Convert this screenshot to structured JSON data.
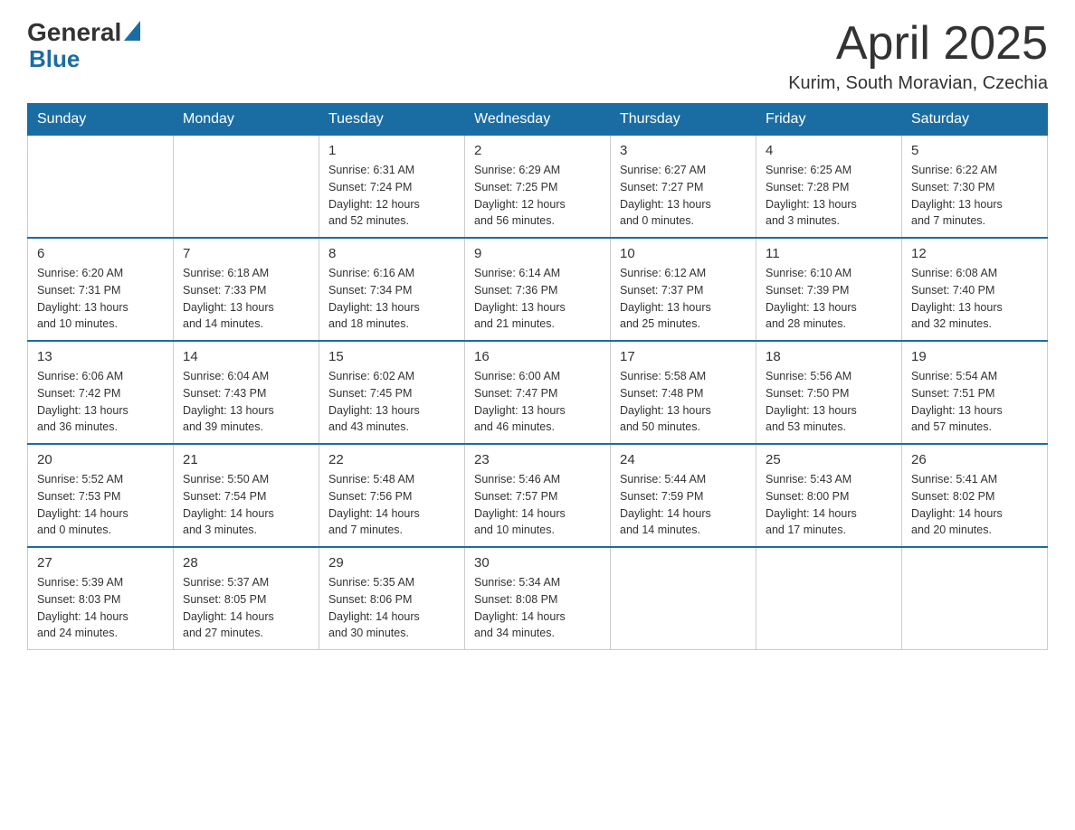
{
  "logo": {
    "text_general": "General",
    "text_blue": "Blue"
  },
  "header": {
    "title": "April 2025",
    "subtitle": "Kurim, South Moravian, Czechia"
  },
  "weekdays": [
    "Sunday",
    "Monday",
    "Tuesday",
    "Wednesday",
    "Thursday",
    "Friday",
    "Saturday"
  ],
  "weeks": [
    [
      {
        "day": "",
        "info": ""
      },
      {
        "day": "",
        "info": ""
      },
      {
        "day": "1",
        "info": "Sunrise: 6:31 AM\nSunset: 7:24 PM\nDaylight: 12 hours\nand 52 minutes."
      },
      {
        "day": "2",
        "info": "Sunrise: 6:29 AM\nSunset: 7:25 PM\nDaylight: 12 hours\nand 56 minutes."
      },
      {
        "day": "3",
        "info": "Sunrise: 6:27 AM\nSunset: 7:27 PM\nDaylight: 13 hours\nand 0 minutes."
      },
      {
        "day": "4",
        "info": "Sunrise: 6:25 AM\nSunset: 7:28 PM\nDaylight: 13 hours\nand 3 minutes."
      },
      {
        "day": "5",
        "info": "Sunrise: 6:22 AM\nSunset: 7:30 PM\nDaylight: 13 hours\nand 7 minutes."
      }
    ],
    [
      {
        "day": "6",
        "info": "Sunrise: 6:20 AM\nSunset: 7:31 PM\nDaylight: 13 hours\nand 10 minutes."
      },
      {
        "day": "7",
        "info": "Sunrise: 6:18 AM\nSunset: 7:33 PM\nDaylight: 13 hours\nand 14 minutes."
      },
      {
        "day": "8",
        "info": "Sunrise: 6:16 AM\nSunset: 7:34 PM\nDaylight: 13 hours\nand 18 minutes."
      },
      {
        "day": "9",
        "info": "Sunrise: 6:14 AM\nSunset: 7:36 PM\nDaylight: 13 hours\nand 21 minutes."
      },
      {
        "day": "10",
        "info": "Sunrise: 6:12 AM\nSunset: 7:37 PM\nDaylight: 13 hours\nand 25 minutes."
      },
      {
        "day": "11",
        "info": "Sunrise: 6:10 AM\nSunset: 7:39 PM\nDaylight: 13 hours\nand 28 minutes."
      },
      {
        "day": "12",
        "info": "Sunrise: 6:08 AM\nSunset: 7:40 PM\nDaylight: 13 hours\nand 32 minutes."
      }
    ],
    [
      {
        "day": "13",
        "info": "Sunrise: 6:06 AM\nSunset: 7:42 PM\nDaylight: 13 hours\nand 36 minutes."
      },
      {
        "day": "14",
        "info": "Sunrise: 6:04 AM\nSunset: 7:43 PM\nDaylight: 13 hours\nand 39 minutes."
      },
      {
        "day": "15",
        "info": "Sunrise: 6:02 AM\nSunset: 7:45 PM\nDaylight: 13 hours\nand 43 minutes."
      },
      {
        "day": "16",
        "info": "Sunrise: 6:00 AM\nSunset: 7:47 PM\nDaylight: 13 hours\nand 46 minutes."
      },
      {
        "day": "17",
        "info": "Sunrise: 5:58 AM\nSunset: 7:48 PM\nDaylight: 13 hours\nand 50 minutes."
      },
      {
        "day": "18",
        "info": "Sunrise: 5:56 AM\nSunset: 7:50 PM\nDaylight: 13 hours\nand 53 minutes."
      },
      {
        "day": "19",
        "info": "Sunrise: 5:54 AM\nSunset: 7:51 PM\nDaylight: 13 hours\nand 57 minutes."
      }
    ],
    [
      {
        "day": "20",
        "info": "Sunrise: 5:52 AM\nSunset: 7:53 PM\nDaylight: 14 hours\nand 0 minutes."
      },
      {
        "day": "21",
        "info": "Sunrise: 5:50 AM\nSunset: 7:54 PM\nDaylight: 14 hours\nand 3 minutes."
      },
      {
        "day": "22",
        "info": "Sunrise: 5:48 AM\nSunset: 7:56 PM\nDaylight: 14 hours\nand 7 minutes."
      },
      {
        "day": "23",
        "info": "Sunrise: 5:46 AM\nSunset: 7:57 PM\nDaylight: 14 hours\nand 10 minutes."
      },
      {
        "day": "24",
        "info": "Sunrise: 5:44 AM\nSunset: 7:59 PM\nDaylight: 14 hours\nand 14 minutes."
      },
      {
        "day": "25",
        "info": "Sunrise: 5:43 AM\nSunset: 8:00 PM\nDaylight: 14 hours\nand 17 minutes."
      },
      {
        "day": "26",
        "info": "Sunrise: 5:41 AM\nSunset: 8:02 PM\nDaylight: 14 hours\nand 20 minutes."
      }
    ],
    [
      {
        "day": "27",
        "info": "Sunrise: 5:39 AM\nSunset: 8:03 PM\nDaylight: 14 hours\nand 24 minutes."
      },
      {
        "day": "28",
        "info": "Sunrise: 5:37 AM\nSunset: 8:05 PM\nDaylight: 14 hours\nand 27 minutes."
      },
      {
        "day": "29",
        "info": "Sunrise: 5:35 AM\nSunset: 8:06 PM\nDaylight: 14 hours\nand 30 minutes."
      },
      {
        "day": "30",
        "info": "Sunrise: 5:34 AM\nSunset: 8:08 PM\nDaylight: 14 hours\nand 34 minutes."
      },
      {
        "day": "",
        "info": ""
      },
      {
        "day": "",
        "info": ""
      },
      {
        "day": "",
        "info": ""
      }
    ]
  ]
}
